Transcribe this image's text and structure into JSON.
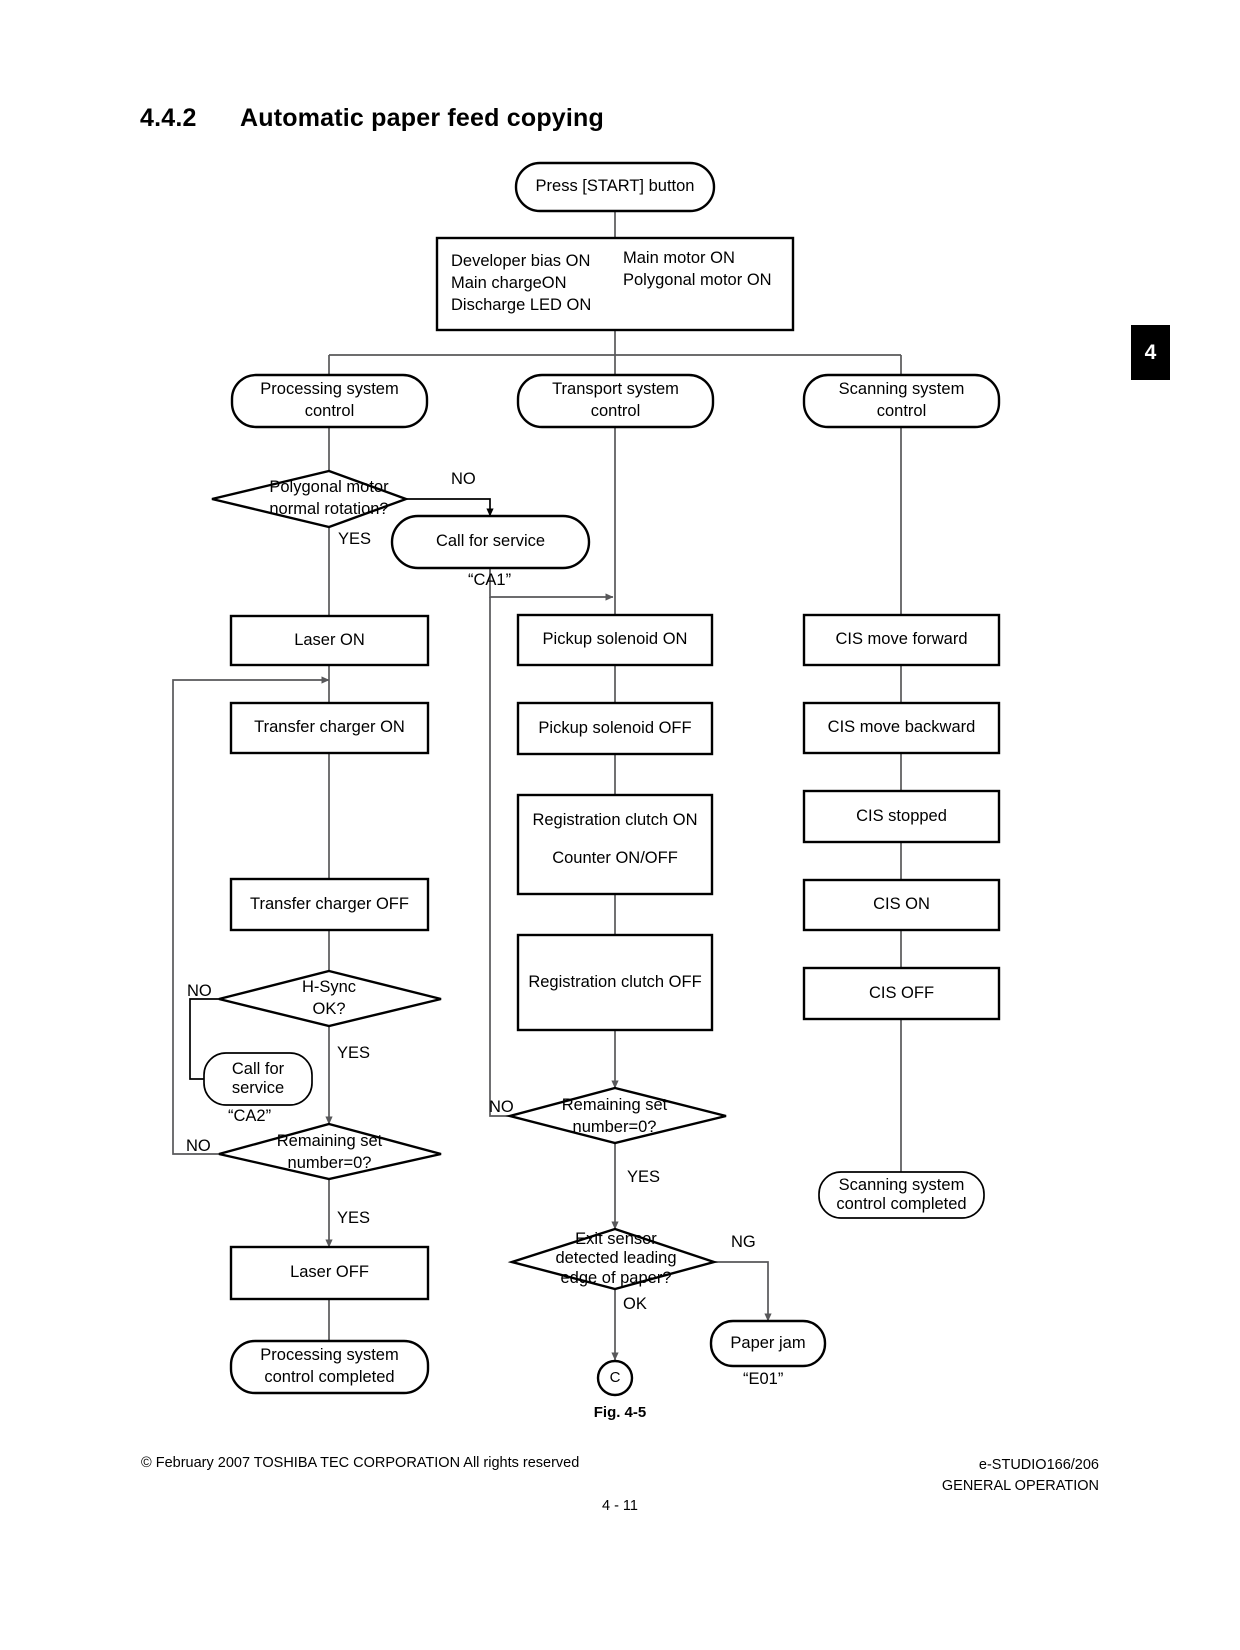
{
  "page": {
    "section_number": "4.4.2",
    "section_title": "Automatic paper feed copying",
    "chapter_tab": "4",
    "figure_caption": "Fig. 4-5",
    "footer": {
      "copyright": "© February 2007 TOSHIBA TEC CORPORATION All rights reserved",
      "model": "e-STUDIO166/206",
      "manual_section": "GENERAL OPERATION",
      "page_number": "4 - 11"
    }
  },
  "flowchart": {
    "type": "flowchart",
    "start": {
      "label": "Press [START] button"
    },
    "init_box": {
      "left_column": [
        "Developer bias ON",
        "Main chargeON",
        "Discharge LED ON"
      ],
      "right_column": [
        "Main motor ON",
        "Polygonal motor ON"
      ]
    },
    "branches": {
      "processing": "Processing system\ncontrol",
      "transport": "Transport system\ncontrol",
      "scanning": "Scanning system\ncontrol"
    },
    "processing_column": {
      "decision_polygonal": "Polygonal motor\nnormal rotation?",
      "polygonal_no": "NO",
      "polygonal_yes": "YES",
      "call_service_1": "Call for service",
      "call_service_1_code": "“CA1”",
      "laser_on": "Laser ON",
      "transfer_charger_on": "Transfer charger ON",
      "transfer_charger_off": "Transfer charger OFF",
      "decision_hsync": "H-Sync\nOK?",
      "hsync_no": "NO",
      "hsync_yes": "YES",
      "call_service_2": "Call for\nservice",
      "call_service_2_code": "“CA2”",
      "decision_remaining": "Remaining set\nnumber=0?",
      "remaining_no": "NO",
      "remaining_yes": "YES",
      "laser_off": "Laser OFF",
      "completed": "Processing system\ncontrol completed"
    },
    "transport_column": {
      "pickup_solenoid_on": "Pickup solenoid ON",
      "pickup_solenoid_off": "Pickup solenoid OFF",
      "registration_clutch_on": "Registration clutch ON\n\nCounter ON/OFF",
      "registration_clutch_on_line1": "Registration clutch ON",
      "registration_clutch_on_line2": "Counter ON/OFF",
      "registration_clutch_off": "Registration clutch OFF",
      "decision_remaining": "Remaining set\nnumber=0?",
      "remaining_no": "NO",
      "remaining_yes": "YES",
      "decision_exit_sensor": "Exit sensor\ndetected leading\nedge of paper?",
      "exit_ng": "NG",
      "exit_ok": "OK",
      "paper_jam": "Paper jam",
      "paper_jam_code": "“E01”",
      "connector_c": "C"
    },
    "scanning_column": {
      "cis_move_forward": "CIS move forward",
      "cis_move_backward": "CIS move backward",
      "cis_stopped": "CIS stopped",
      "cis_on": "CIS ON",
      "cis_off": "CIS OFF",
      "completed": "Scanning system\ncontrol completed"
    },
    "colors": {
      "node_stroke": "#000000",
      "connector_stroke": "#58585a",
      "text": "#231f20",
      "page_background": "#ffffff"
    }
  }
}
